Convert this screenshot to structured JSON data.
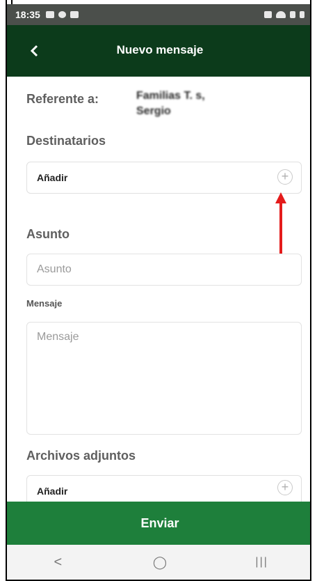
{
  "status_bar": {
    "time": "18:35"
  },
  "app_bar": {
    "title": "Nuevo mensaje"
  },
  "form": {
    "referente_label": "Referente a:",
    "referente_value_line1": "Familias T. s,",
    "referente_value_line2": "Sergio",
    "destinatarios_label": "Destinatarios",
    "destinatarios_add": "Añadir",
    "asunto_label": "Asunto",
    "asunto_placeholder": "Asunto",
    "mensaje_label": "Mensaje",
    "mensaje_placeholder": "Mensaje",
    "adjuntos_label": "Archivos adjuntos",
    "adjuntos_add": "Añadir",
    "plus_glyph": "+"
  },
  "actions": {
    "send_label": "Enviar"
  },
  "nav": {
    "back_glyph": "<",
    "home_glyph": "◯",
    "recents_glyph": "|||"
  },
  "colors": {
    "app_bar": "#0c3b1b",
    "send_button": "#1e7f3b",
    "annotation_arrow": "#e41b1b"
  }
}
